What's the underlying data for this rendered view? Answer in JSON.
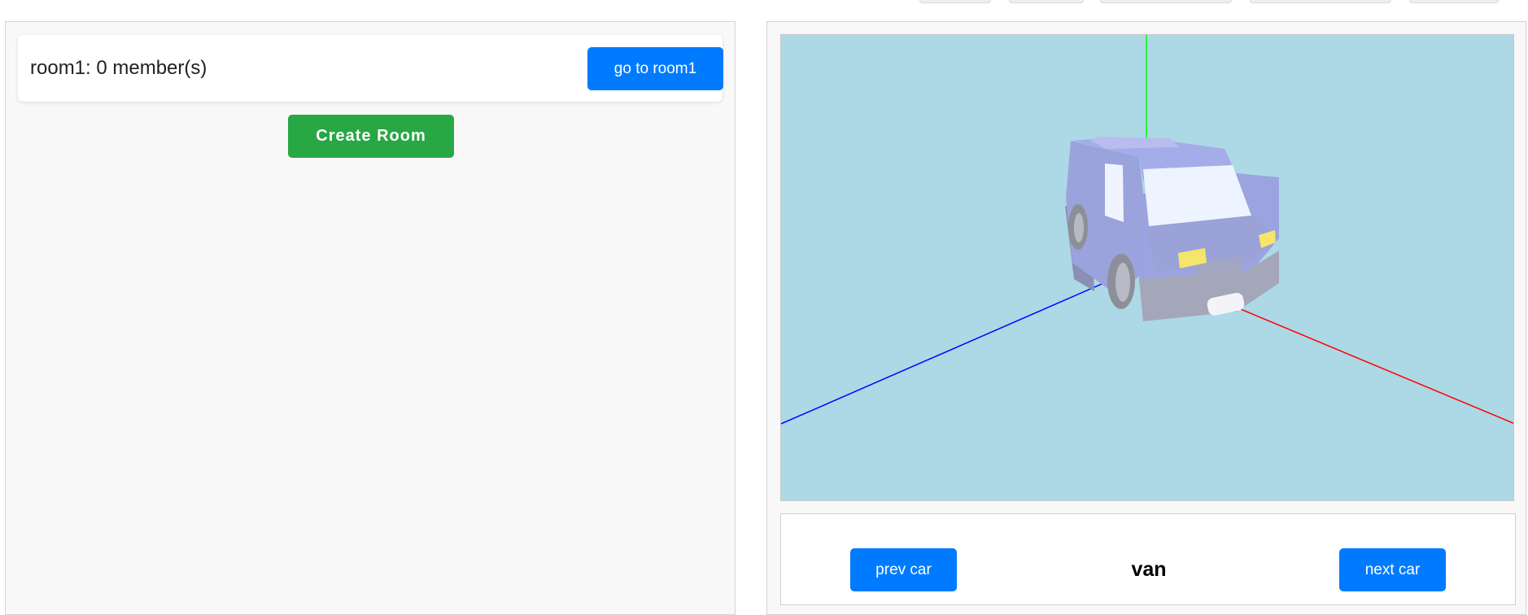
{
  "rooms": [
    {
      "label": "room1: 0 member(s)",
      "button_label": "go to room1"
    }
  ],
  "create_room_label": "Create Room",
  "car_viewer": {
    "prev_label": "prev car",
    "next_label": "next car",
    "current_car": "van"
  },
  "colors": {
    "primary_button": "#007bff",
    "success_button": "#28a745",
    "viewport_background": "#add8e6",
    "axis_x": "#ff0000",
    "axis_y": "#00ff00",
    "axis_z": "#0000ff",
    "car_body": "#9aa3dc",
    "headlight": "#f5e66a"
  }
}
